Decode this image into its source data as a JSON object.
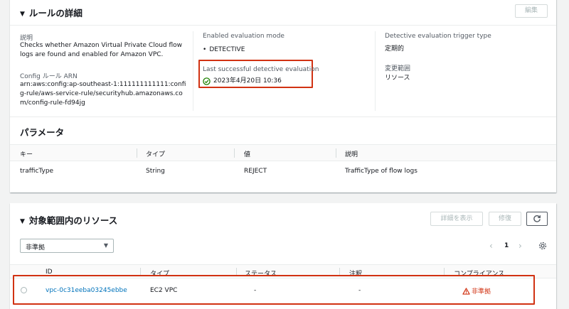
{
  "rule_details": {
    "title": "ルールの詳細",
    "edit_button": "編集",
    "description_label": "説明",
    "description_value": "Checks whether Amazon Virtual Private Cloud flow logs are found and enabled for Amazon VPC.",
    "arn_label": "Config ルール ARN",
    "arn_value": "arn:aws:config:ap-southeast-1:111111111111:config-rule/aws-service-rule/securityhub.amazonaws.com/config-rule-fd94jg",
    "eval_mode_label": "Enabled evaluation mode",
    "eval_mode_value": "DETECTIVE",
    "last_eval_label": "Last successful detective evaluation",
    "last_eval_value": "2023年4月20日 10:36",
    "trigger_label": "Detective evaluation trigger type",
    "trigger_value": "定期的",
    "scope_label": "変更範囲",
    "scope_value": "リソース"
  },
  "parameters": {
    "title": "パラメータ",
    "headers": [
      "キー",
      "タイプ",
      "値",
      "説明"
    ],
    "rows": [
      [
        "trafficType",
        "String",
        "REJECT",
        "TrafficType of flow logs"
      ]
    ]
  },
  "resources": {
    "title": "対象範囲内のリソース",
    "details_button": "詳細を表示",
    "fix_button": "修復",
    "filter_value": "非準拠",
    "page_number": "1",
    "headers": [
      "ID",
      "タイプ",
      "ステータス",
      "注釈",
      "コンプライアンス"
    ],
    "rows": [
      {
        "id": "vpc-0c31eeba03245ebbe",
        "type": "EC2 VPC",
        "status": "-",
        "annotation": "-",
        "compliance": "非準拠"
      }
    ]
  },
  "colors": {
    "highlight": "#d13212",
    "link": "#0073bb",
    "success": "#1d8102"
  }
}
